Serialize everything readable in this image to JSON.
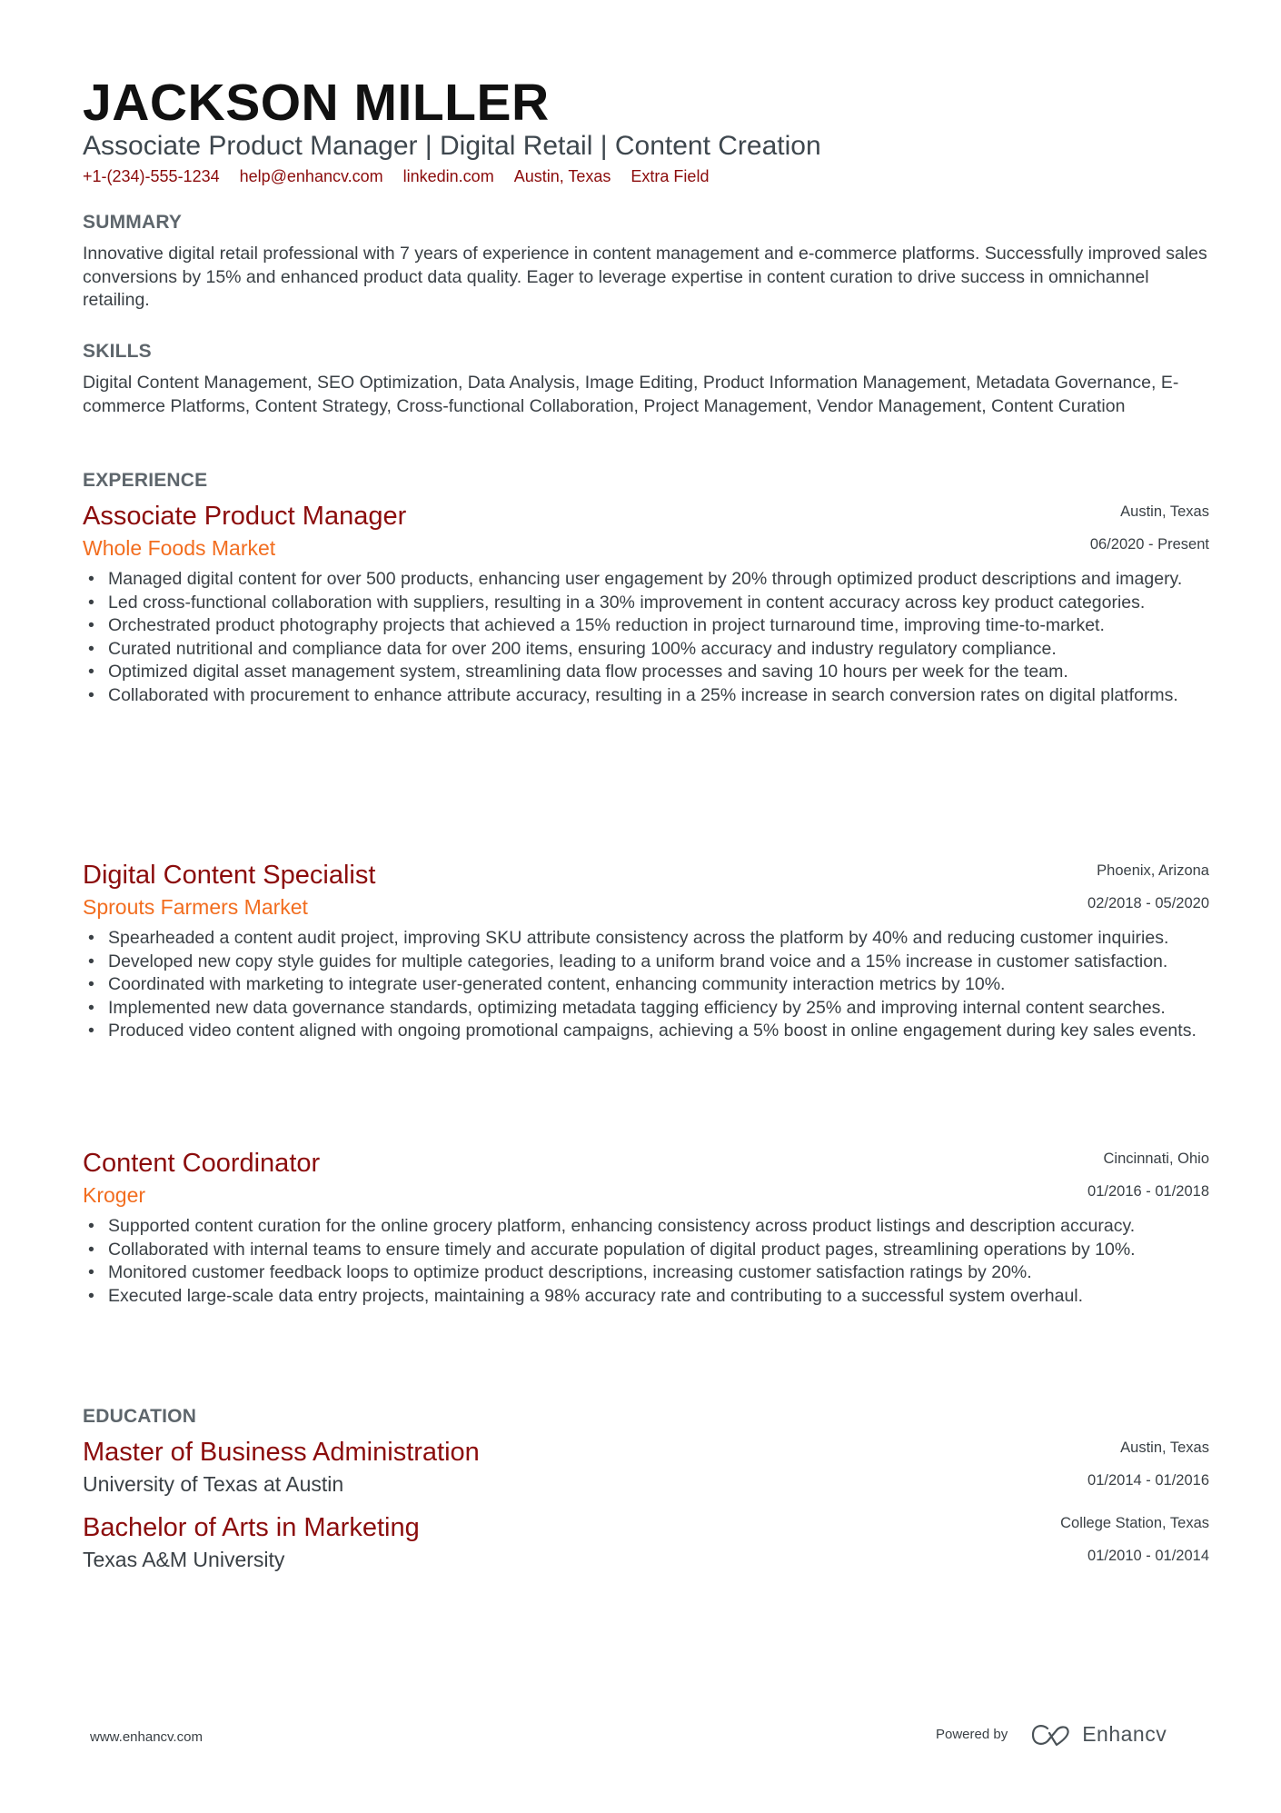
{
  "header": {
    "name": "JACKSON MILLER",
    "headline": "Associate Product Manager | Digital Retail | Content Creation",
    "contacts": [
      "+1-(234)-555-1234",
      "help@enhancv.com",
      "linkedin.com",
      "Austin, Texas",
      "Extra Field"
    ]
  },
  "summary": {
    "title": "SUMMARY",
    "text": "Innovative digital retail professional with 7 years of experience in content management and e-commerce platforms. Successfully improved sales conversions by 15% and enhanced product data quality. Eager to leverage expertise in content curation to drive success in omnichannel retailing."
  },
  "skills": {
    "title": "SKILLS",
    "text": "Digital Content Management, SEO Optimization, Data Analysis, Image Editing, Product Information Management, Metadata Governance, E-commerce Platforms, Content Strategy, Cross-functional Collaboration, Project Management, Vendor Management, Content Curation"
  },
  "experience": {
    "title": "EXPERIENCE",
    "items": [
      {
        "role": "Associate Product Manager",
        "company": "Whole Foods Market",
        "location": "Austin, Texas",
        "dates": "06/2020 - Present",
        "bullets": [
          "Managed digital content for over 500 products, enhancing user engagement by 20% through optimized product descriptions and imagery.",
          "Led cross-functional collaboration with suppliers, resulting in a 30% improvement in content accuracy across key product categories.",
          "Orchestrated product photography projects that achieved a 15% reduction in project turnaround time, improving time-to-market.",
          "Curated nutritional and compliance data for over 200 items, ensuring 100% accuracy and industry regulatory compliance.",
          "Optimized digital asset management system, streamlining data flow processes and saving 10 hours per week for the team.",
          "Collaborated with procurement to enhance attribute accuracy, resulting in a 25% increase in search conversion rates on digital platforms."
        ]
      },
      {
        "role": "Digital Content Specialist",
        "company": "Sprouts Farmers Market",
        "location": "Phoenix, Arizona",
        "dates": "02/2018 - 05/2020",
        "bullets": [
          "Spearheaded a content audit project, improving SKU attribute consistency across the platform by 40% and reducing customer inquiries.",
          "Developed new copy style guides for multiple categories, leading to a uniform brand voice and a 15% increase in customer satisfaction.",
          "Coordinated with marketing to integrate user-generated content, enhancing community interaction metrics by 10%.",
          "Implemented new data governance standards, optimizing metadata tagging efficiency by 25% and improving internal content searches.",
          "Produced video content aligned with ongoing promotional campaigns, achieving a 5% boost in online engagement during key sales events."
        ]
      },
      {
        "role": "Content Coordinator",
        "company": "Kroger",
        "location": "Cincinnati, Ohio",
        "dates": "01/2016 - 01/2018",
        "bullets": [
          "Supported content curation for the online grocery platform, enhancing consistency across product listings and description accuracy.",
          "Collaborated with internal teams to ensure timely and accurate population of digital product pages, streamlining operations by 10%.",
          "Monitored customer feedback loops to optimize product descriptions, increasing customer satisfaction ratings by 20%.",
          "Executed large-scale data entry projects, maintaining a 98% accuracy rate and contributing to a successful system overhaul."
        ]
      }
    ]
  },
  "education": {
    "title": "EDUCATION",
    "items": [
      {
        "degree": "Master of Business Administration",
        "school": "University of Texas at Austin",
        "location": "Austin, Texas",
        "dates": "01/2014 - 01/2016"
      },
      {
        "degree": "Bachelor of Arts in Marketing",
        "school": "Texas A&M University",
        "location": "College Station, Texas",
        "dates": "01/2010 - 01/2014"
      }
    ]
  },
  "footer": {
    "website": "www.enhancv.com",
    "powered_by": "Powered by",
    "brand": "Enhancv",
    "brand_icon": "enhancv-logo-icon"
  }
}
